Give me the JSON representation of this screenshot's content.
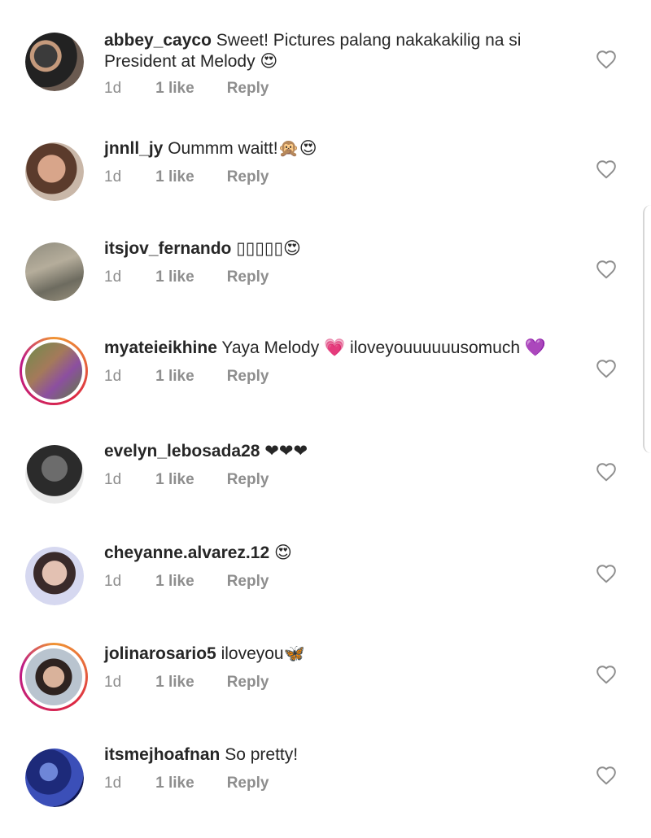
{
  "comments": [
    {
      "username": "abbey_cayco",
      "text": "Sweet! Pictures palang nakakakilig na si President at Melody 😍",
      "time": "1d",
      "likes": "1 like",
      "reply": "Reply",
      "avatar": "photo-couple-avatar",
      "story_ring": false
    },
    {
      "username": "jnnll_jy",
      "text": "Oummm waitt!🙊😍",
      "time": "1d",
      "likes": "1 like",
      "reply": "Reply",
      "avatar": "photo-selfie-avatar",
      "story_ring": false
    },
    {
      "username": "itsjov_fernando",
      "text": "▯▯▯▯▯😍",
      "time": "1d",
      "likes": "1 like",
      "reply": "Reply",
      "avatar": "photo-outdoor-avatar",
      "story_ring": false
    },
    {
      "username": "myateieikhine",
      "text": "Yaya Melody 💗 iloveyouuuuuusomuch 💜",
      "time": "1d",
      "likes": "1 like",
      "reply": "Reply",
      "avatar": "photo-garden-avatar",
      "story_ring": true
    },
    {
      "username": "evelyn_lebosada28",
      "text": "❤❤❤",
      "time": "1d",
      "likes": "1 like",
      "reply": "Reply",
      "avatar": "photo-bw-portrait-avatar",
      "story_ring": false
    },
    {
      "username": "cheyanne.alvarez.12",
      "text": "😍",
      "time": "1d",
      "likes": "1 like",
      "reply": "Reply",
      "avatar": "photo-filter-portrait-avatar",
      "story_ring": false
    },
    {
      "username": "jolinarosario5",
      "text": "iloveyou🦋",
      "time": "1d",
      "likes": "1 like",
      "reply": "Reply",
      "avatar": "photo-portrait-avatar",
      "story_ring": true
    },
    {
      "username": "itsmejhoafnan",
      "text": "So pretty!",
      "time": "1d",
      "likes": "1 like",
      "reply": "Reply",
      "avatar": "photo-blue-flowers-avatar",
      "story_ring": false
    }
  ],
  "icons": {
    "like": "heart-outline-icon"
  },
  "colors": {
    "text": "#262626",
    "meta": "#8e8e8e",
    "ring_start": "#f09433",
    "ring_end": "#bc1888"
  }
}
